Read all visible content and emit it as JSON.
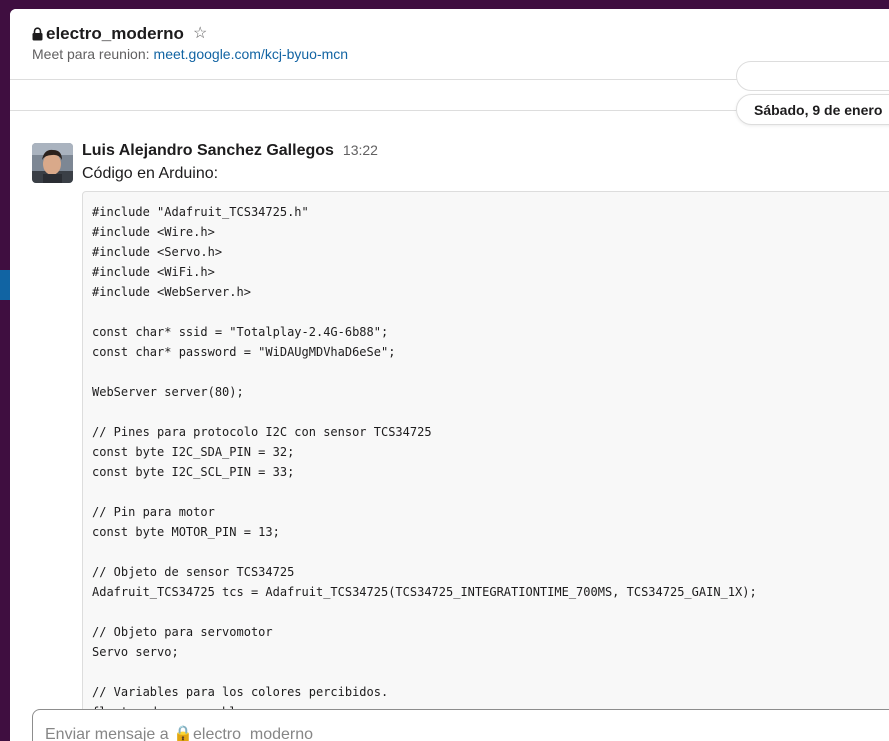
{
  "channel": {
    "name": "electro_moderno",
    "topic_label": "Meet para reunion:",
    "topic_link": "meet.google.com/kcj-byuo-mcn"
  },
  "date_divider": {
    "label": "Sábado, 9 de enero"
  },
  "message": {
    "sender": "Luis Alejandro Sanchez Gallegos",
    "time": "13:22",
    "text": "Código en Arduino:",
    "code_lines": [
      "#include \"Adafruit_TCS34725.h\"",
      "#include <Wire.h>",
      "#include <Servo.h>",
      "#include <WiFi.h>",
      "#include <WebServer.h>",
      "",
      "const char* ssid = \"Totalplay-2.4G-6b88\";",
      "const char* password = \"WiDAUgMDVhaD6eSe\";",
      "",
      "WebServer server(80);",
      "",
      "// Pines para protocolo I2C con sensor TCS34725",
      "const byte I2C_SDA_PIN = 32;",
      "const byte I2C_SCL_PIN = 33;",
      "",
      "// Pin para motor",
      "const byte MOTOR_PIN = 13;",
      "",
      "// Objeto de sensor TCS34725",
      "Adafruit_TCS34725 tcs = Adafruit_TCS34725(TCS34725_INTEGRATIONTIME_700MS, TCS34725_GAIN_1X);",
      "",
      "// Objeto para servomotor",
      "Servo servo;",
      "",
      "// Variables para los colores percibidos.",
      "float red, green, blue;"
    ]
  },
  "composer": {
    "placeholder": "Enviar mensaje a 🔒electro_moderno"
  },
  "colors": {
    "sidebar": "#3f0e40",
    "link": "#1264a3",
    "accent": "#1164a3"
  }
}
